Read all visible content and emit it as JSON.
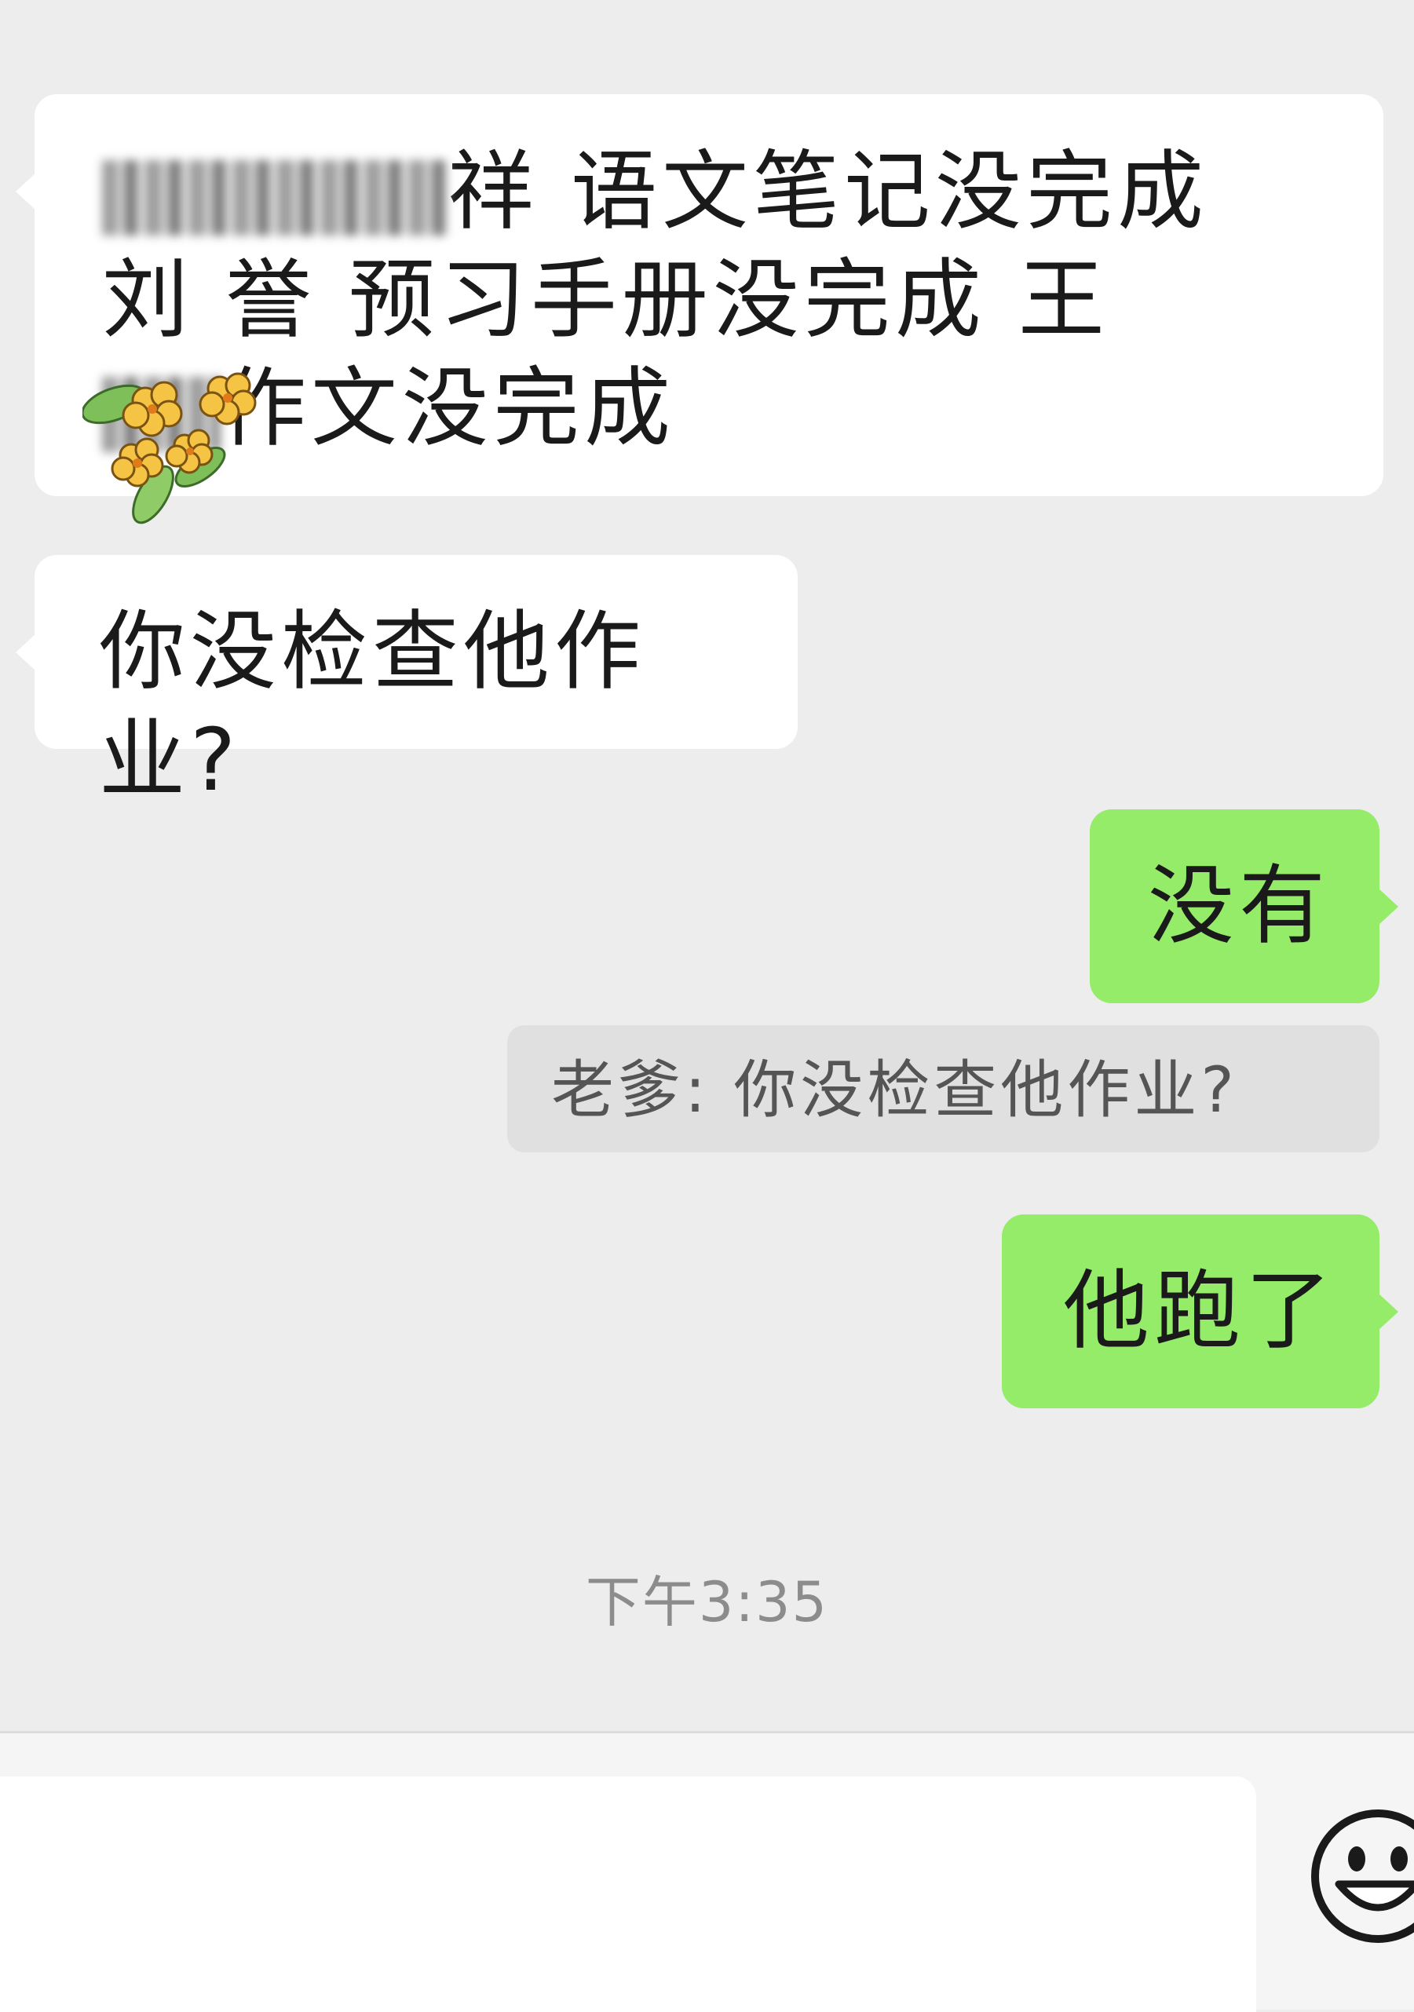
{
  "messages": [
    {
      "direction": "incoming",
      "lines": [
        "祥 语文笔记没完成",
        "刘 誉 预习手册没完成 王",
        "作文没完成"
      ],
      "redacted": true
    },
    {
      "direction": "incoming",
      "text": "你没检查他作业?"
    },
    {
      "direction": "outgoing",
      "text": "没有"
    },
    {
      "direction": "outgoing",
      "text": "他跑了"
    }
  ],
  "quote": {
    "sender": "老爹:",
    "text": "你没检查他作业?"
  },
  "timestamp": "下午3:35",
  "input": {
    "value": "",
    "placeholder": ""
  },
  "icons": {
    "emoji": "smiley-icon",
    "sticker": "flower-sticker-icon"
  },
  "colors": {
    "background": "#ededed",
    "incoming": "#ffffff",
    "outgoing": "#95ec69",
    "quote": "#e0e0e0",
    "timestamp": "#8c8c8c"
  }
}
